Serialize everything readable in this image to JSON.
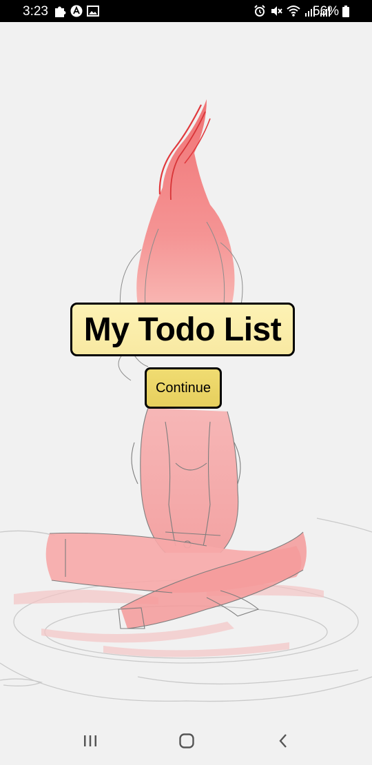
{
  "status_bar": {
    "time": "3:23",
    "battery": "56%",
    "left_icons": [
      "puzzle-icon",
      "app-a-icon",
      "image-icon"
    ],
    "right_icons": [
      "alarm-icon",
      "mute-icon",
      "wifi-icon",
      "signal-icon",
      "signal-icon"
    ]
  },
  "main": {
    "title": "My Todo List",
    "continue_label": "Continue"
  },
  "nav_bar": {
    "buttons": [
      "recent-apps-icon",
      "home-icon",
      "back-icon"
    ]
  },
  "colors": {
    "background": "#f1f1f1",
    "title_bg": "#fbeeab",
    "button_bg": "#eed86a",
    "illustration_red": "#f58a8a"
  }
}
